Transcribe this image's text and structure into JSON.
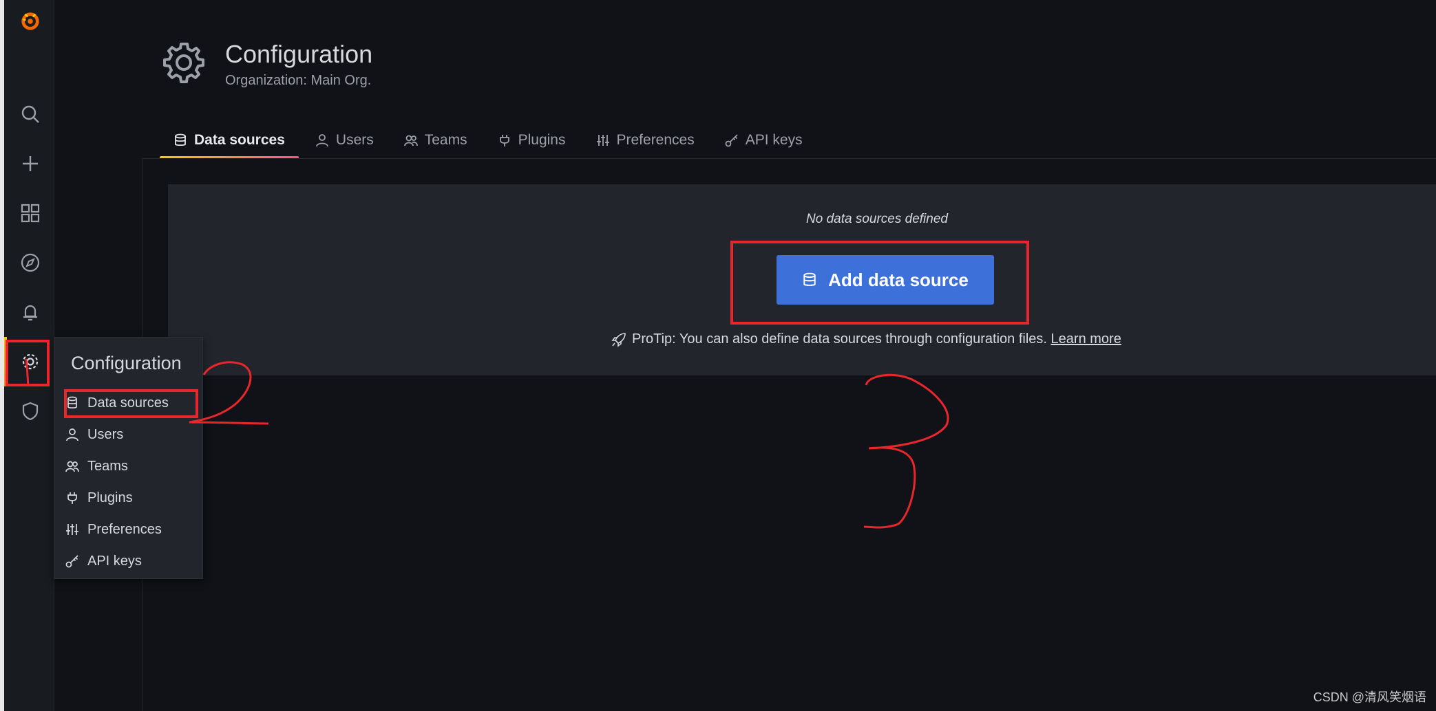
{
  "sidebar": {
    "logo": "grafana-logo-icon",
    "items": [
      "search-icon",
      "plus-icon",
      "dashboards-icon",
      "explore-icon",
      "alerting-icon",
      "gear-icon",
      "shield-icon"
    ]
  },
  "header": {
    "title": "Configuration",
    "subtitle": "Organization: Main Org."
  },
  "tabs": [
    {
      "label": "Data sources",
      "icon": "database-icon",
      "active": true
    },
    {
      "label": "Users",
      "icon": "user-icon",
      "active": false
    },
    {
      "label": "Teams",
      "icon": "users-icon",
      "active": false
    },
    {
      "label": "Plugins",
      "icon": "plug-icon",
      "active": false
    },
    {
      "label": "Preferences",
      "icon": "sliders-icon",
      "active": false
    },
    {
      "label": "API keys",
      "icon": "key-icon",
      "active": false
    }
  ],
  "empty_state": {
    "message": "No data sources defined",
    "button_label": "Add data source",
    "protip": "ProTip: You can also define data sources through configuration files. ",
    "learn_more": "Learn more"
  },
  "dropdown": {
    "title": "Configuration",
    "items": [
      "Data sources",
      "Users",
      "Teams",
      "Plugins",
      "Preferences",
      "API keys"
    ]
  },
  "annotations": {
    "marks": [
      "1",
      "2",
      "3"
    ],
    "color": "#e8262b"
  },
  "watermark": "CSDN @清风笑烟语",
  "colors": {
    "background": "#111217",
    "sidebar": "#181b1f",
    "card": "#22252b",
    "primary_button": "#3d71d9",
    "accent": "#ff8833"
  }
}
